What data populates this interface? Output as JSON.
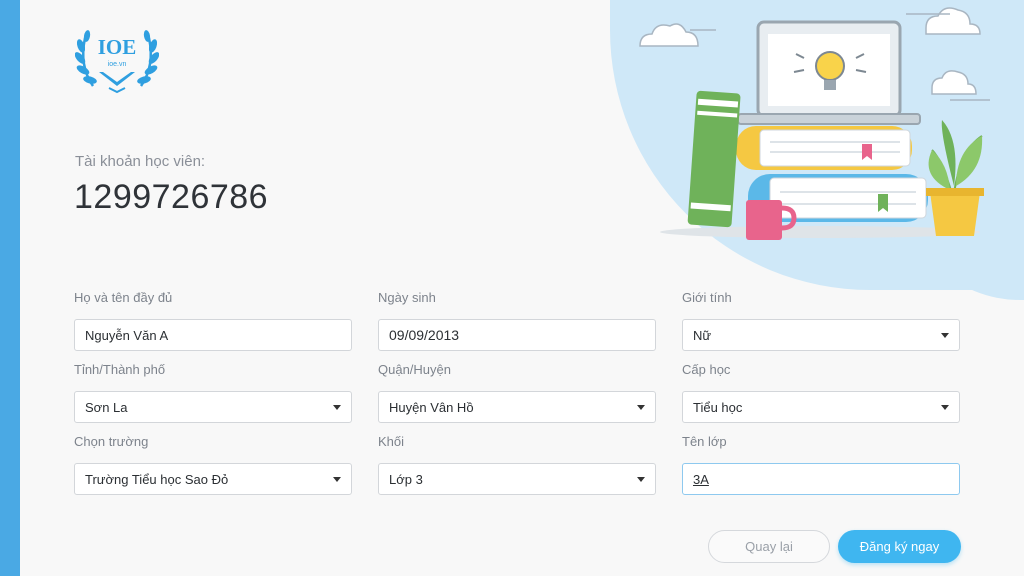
{
  "logo": {
    "text": "IOE",
    "subtext": "ioe.vn"
  },
  "account": {
    "label": "Tài khoản học viên:",
    "id": "1299726786"
  },
  "form": {
    "full_name": {
      "label": "Họ và tên đầy đủ",
      "value": "Nguyễn Văn A"
    },
    "birth_date": {
      "label": "Ngày sinh",
      "value": "09/09/2013"
    },
    "gender": {
      "label": "Giới tính",
      "value": "Nữ"
    },
    "province": {
      "label": "Tỉnh/Thành phố",
      "value": "Sơn La"
    },
    "district": {
      "label": "Quận/Huyện",
      "value": "Huyện Vân Hồ"
    },
    "level": {
      "label": "Cấp học",
      "value": "Tiểu học"
    },
    "school": {
      "label": "Chọn trường",
      "value": "Trường Tiểu học Sao Đỏ"
    },
    "grade": {
      "label": "Khối",
      "value": "Lớp 3"
    },
    "class_name": {
      "label": "Tên lớp",
      "value": "3A"
    }
  },
  "buttons": {
    "back": "Quay lại",
    "register": "Đăng ký ngay"
  },
  "colors": {
    "accent": "#3fb6f0",
    "background": "#f8f8f8",
    "edge": "#4aa9e4",
    "book_green": "#6fb25a",
    "book_yellow": "#f5c842",
    "book_blue": "#5bb8e8",
    "mug": "#e8648c"
  },
  "icons": [
    "laurel-logo-icon",
    "lightbulb-icon",
    "cloud-icon",
    "plant-icon",
    "dropdown-caret-icon"
  ]
}
